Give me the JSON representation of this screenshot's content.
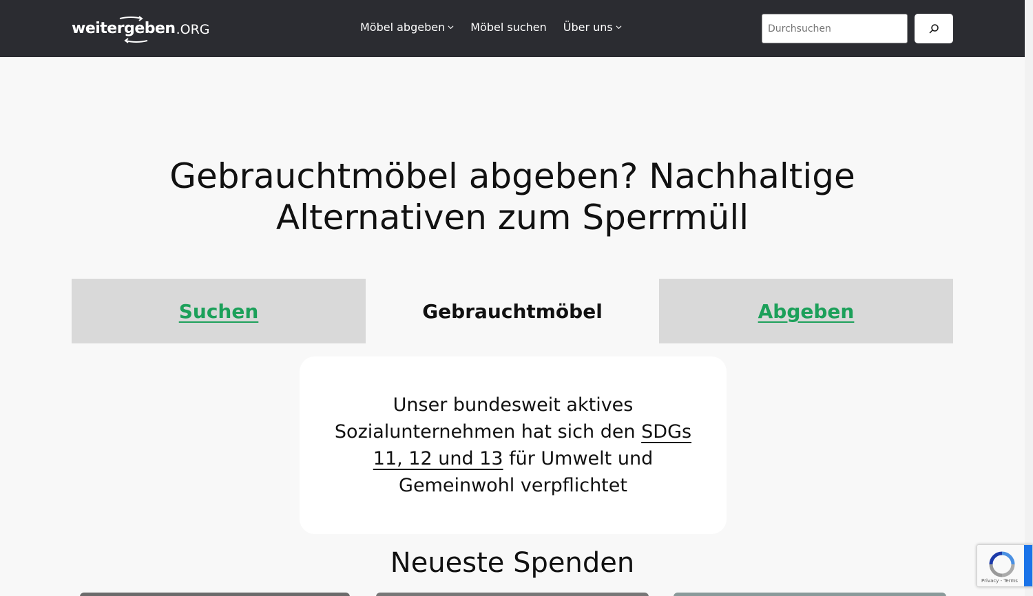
{
  "header": {
    "logo": {
      "main": "weitergeben",
      "suffix": ".ORG"
    },
    "nav": [
      {
        "label": "Möbel abgeben",
        "has_dropdown": true
      },
      {
        "label": "Möbel suchen",
        "has_dropdown": false
      },
      {
        "label": "Über uns",
        "has_dropdown": true
      }
    ],
    "search": {
      "placeholder": "Durchsuchen",
      "button_icon": "search-icon"
    }
  },
  "hero": {
    "title": "Gebrauchtmöbel abgeben? Nachhaltige Alternativen zum Sperrmüll"
  },
  "tabs": {
    "left": "Suchen",
    "middle": "Gebrauchtmöbel",
    "right": "Abgeben"
  },
  "info": {
    "text_before": "Unser bundesweit aktives Sozialunternehmen hat sich den ",
    "link": "SDGs 11, 12 und 13",
    "text_after": " für Umwelt und Gemeinwohl verpflichtet"
  },
  "section": {
    "title": "Neueste Spenden"
  },
  "recaptcha": {
    "links": "Privacy - Terms"
  },
  "colors": {
    "header_bg": "#2b2c31",
    "page_bg": "#f8f8f8",
    "accent_green": "#1ca05a",
    "tab_bg": "#d9d9d9"
  }
}
